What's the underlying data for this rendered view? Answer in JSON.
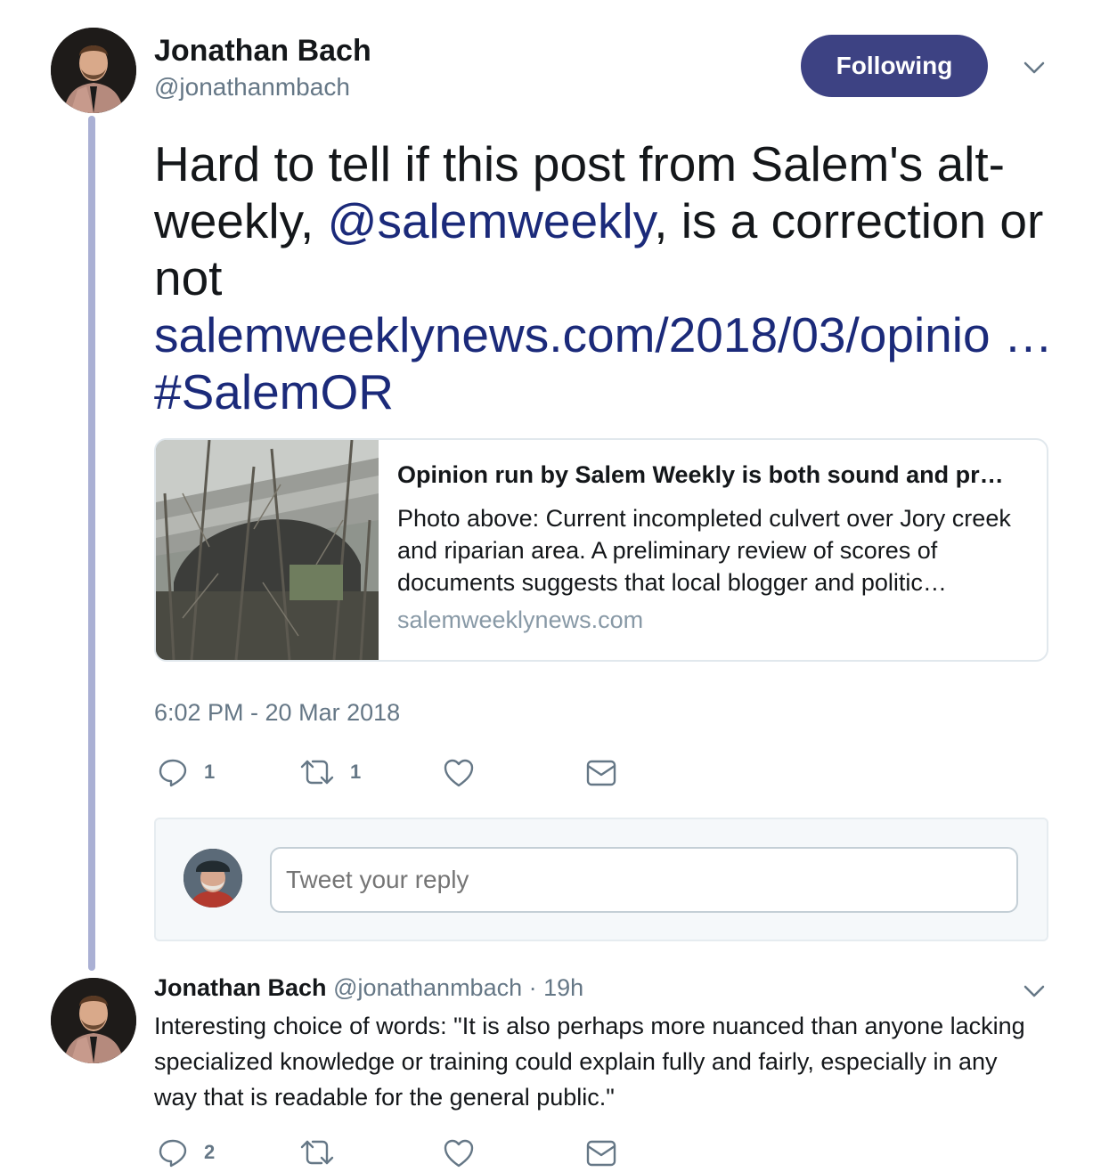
{
  "tweet": {
    "author_name": "Jonathan Bach",
    "author_handle": "@jonathanmbach",
    "follow_label": "Following",
    "text_part1": "Hard to tell if this post from Salem's alt-weekly, ",
    "mention": "@salemweekly",
    "text_part2": ", is a correction or not ",
    "url": "salemweeklynews.com/2018/03/opinio …",
    "hashtag": "#SalemOR",
    "card": {
      "title": "Opinion run by Salem Weekly is both sound and pr…",
      "description": "Photo above: Current incompleted culvert over Jory creek and riparian area. A preliminary review of scores of documents suggests that local blogger and politic…",
      "domain": "salemweeklynews.com"
    },
    "timestamp": "6:02 PM - 20 Mar 2018",
    "actions": {
      "reply_count": "1",
      "retweet_count": "1"
    }
  },
  "reply_box": {
    "placeholder": "Tweet your reply"
  },
  "reply": {
    "author_name": "Jonathan Bach",
    "author_handle": "@jonathanmbach",
    "separator": "·",
    "time": "19h",
    "text": "Interesting choice of words: \"It is also perhaps more nuanced than anyone lacking specialized knowledge or training could explain fully and fairly, especially in any way that is readable for the general public.\"",
    "actions": {
      "reply_count": "2"
    }
  },
  "colors": {
    "follow_button": "#3d4283",
    "link": "#1b2a7a",
    "thread_line": "#aab0d4",
    "muted": "#657786"
  },
  "icons": [
    "reply-icon",
    "retweet-icon",
    "like-icon",
    "message-icon",
    "chevron-down-icon"
  ]
}
